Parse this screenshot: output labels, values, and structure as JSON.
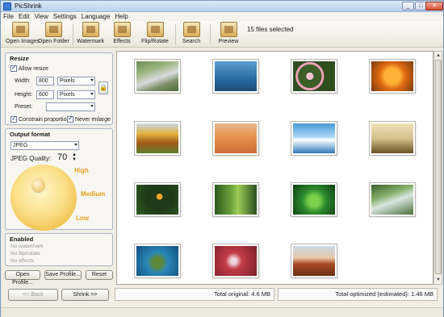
{
  "window": {
    "title": "PicShrink"
  },
  "menu": [
    "File",
    "Edit",
    "View",
    "Settings",
    "Language",
    "Help"
  ],
  "toolbar": {
    "buttons": [
      {
        "label": "Open Images",
        "icon": "open-images-icon"
      },
      {
        "label": "Open Folder",
        "icon": "open-folder-icon"
      },
      {
        "label": "Watermark",
        "icon": "watermark-icon"
      },
      {
        "label": "Effects",
        "icon": "effects-icon"
      },
      {
        "label": "Flip/Rotate",
        "icon": "flip-rotate-icon"
      },
      {
        "label": "Search",
        "icon": "search-icon"
      },
      {
        "label": "Preview",
        "icon": "preview-icon"
      }
    ],
    "selection_status": "15 files selected"
  },
  "resize": {
    "title": "Resize",
    "allow_resize_label": "Allow resize",
    "allow_resize": true,
    "width_label": "Width:",
    "width_value": "800",
    "width_unit": "Pixels",
    "height_label": "Height:",
    "height_value": "600",
    "height_unit": "Pixels",
    "preset_label": "Preset:",
    "preset_value": "",
    "constrain_label": "Constrain proportions",
    "constrain": true,
    "never_enlarge_label": "Never enlarge",
    "never_enlarge": true
  },
  "output": {
    "title": "Output format",
    "format": "JPEG",
    "quality_label": "JPEG Quality:",
    "quality_value": "70",
    "high_label": "High",
    "medium_label": "Medium",
    "low_label": "Low"
  },
  "enabled": {
    "title": "Enabled",
    "items": [
      "No watermark",
      "No flip/rotate",
      "No effects"
    ]
  },
  "profile_buttons": {
    "open": "Open Profile...",
    "save": "Save Profile...",
    "reset": "Reset"
  },
  "navigation": {
    "back": "<< Back",
    "shrink": "Shrink >>"
  },
  "totals": {
    "original": "Total original: 4.6 MB",
    "optimized": "Total optimized (estimated): 1.46 MB"
  },
  "colors": {
    "accent": "#e8a21e",
    "panel_border": "#a9b6c9",
    "titlebar": "#b9d1ee"
  },
  "thumbnails": [
    {
      "name": "river-landscape"
    },
    {
      "name": "whale-tail"
    },
    {
      "name": "pink-flowers"
    },
    {
      "name": "orange-flowers"
    },
    {
      "name": "autumn-tree"
    },
    {
      "name": "desert-oryx"
    },
    {
      "name": "icebergs"
    },
    {
      "name": "savanna-trees"
    },
    {
      "name": "toucan"
    },
    {
      "name": "forest-path"
    },
    {
      "name": "green-fern"
    },
    {
      "name": "waterfall-stream"
    },
    {
      "name": "sea-turtle"
    },
    {
      "name": "red-leaves"
    },
    {
      "name": "desert-mesa"
    }
  ]
}
